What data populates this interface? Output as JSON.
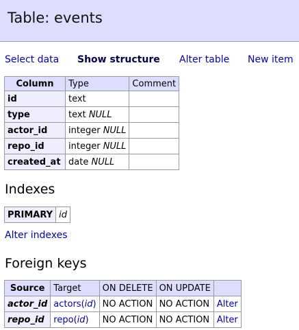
{
  "header": {
    "title": "Table: events"
  },
  "nav": {
    "select_data": "Select data",
    "show_structure": "Show structure",
    "alter_table": "Alter table",
    "new_item": "New item"
  },
  "structure": {
    "headers": {
      "column": "Column",
      "type": "Type",
      "comment": "Comment"
    },
    "rows": [
      {
        "name": "id",
        "type": "text",
        "null": ""
      },
      {
        "name": "type",
        "type": "text",
        "null": "NULL"
      },
      {
        "name": "actor_id",
        "type": "integer",
        "null": "NULL"
      },
      {
        "name": "repo_id",
        "type": "integer",
        "null": "NULL"
      },
      {
        "name": "created_at",
        "type": "date",
        "null": "NULL"
      }
    ]
  },
  "indexes": {
    "heading": "Indexes",
    "rows": [
      {
        "type": "PRIMARY",
        "column": "id"
      }
    ],
    "alter_link": "Alter indexes"
  },
  "foreign_keys": {
    "heading": "Foreign keys",
    "headers": {
      "source": "Source",
      "target": "Target",
      "on_delete": "ON DELETE",
      "on_update": "ON UPDATE"
    },
    "rows": [
      {
        "source": "actor_id",
        "target_table": "actors",
        "target_col": "id",
        "on_delete": "NO ACTION",
        "on_update": "NO ACTION",
        "action": "Alter"
      },
      {
        "source": "repo_id",
        "target_table": "repo",
        "target_col": "id",
        "on_delete": "NO ACTION",
        "on_update": "NO ACTION",
        "action": "Alter"
      }
    ]
  }
}
